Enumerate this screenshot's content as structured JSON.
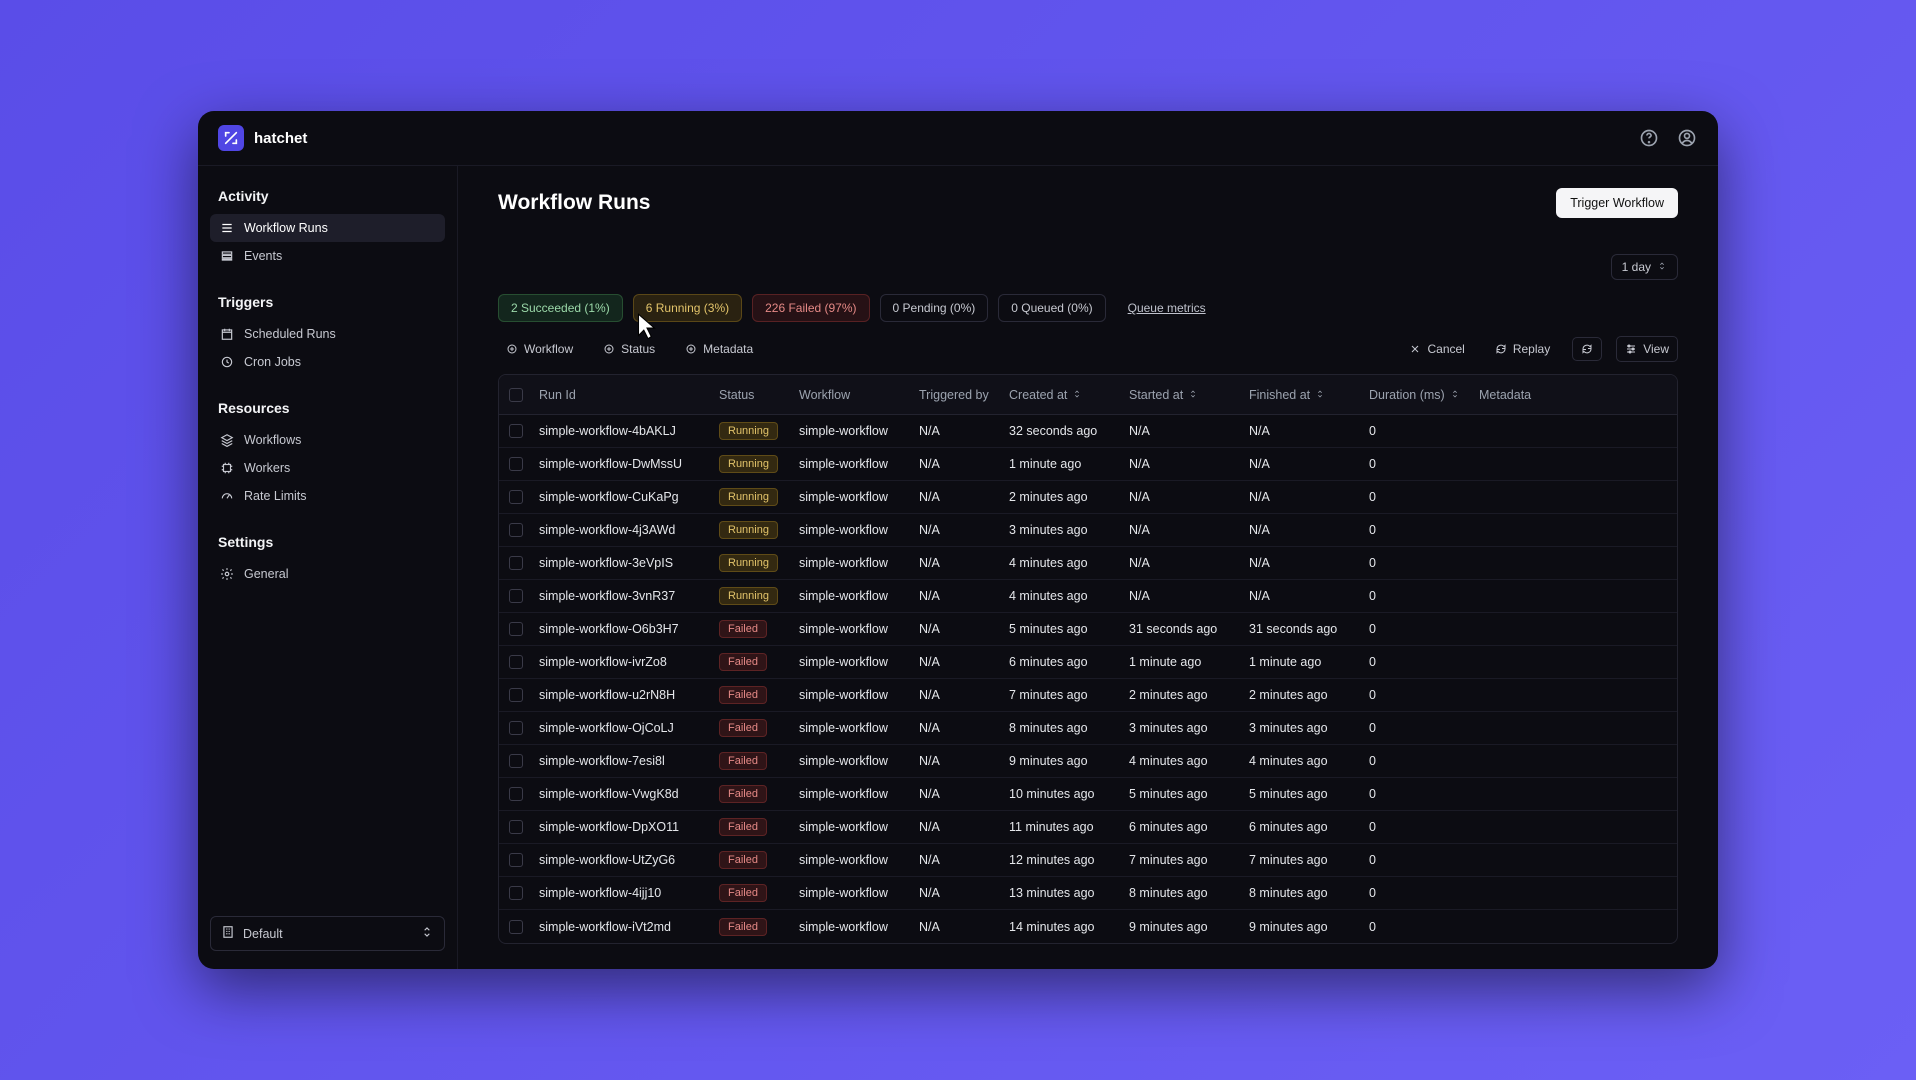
{
  "brand": "hatchet",
  "sidebar": {
    "sections": [
      {
        "heading": "Activity",
        "items": [
          {
            "label": "Workflow Runs",
            "icon": "list",
            "active": true
          },
          {
            "label": "Events",
            "icon": "rows"
          }
        ]
      },
      {
        "heading": "Triggers",
        "items": [
          {
            "label": "Scheduled Runs",
            "icon": "calendar"
          },
          {
            "label": "Cron Jobs",
            "icon": "clock"
          }
        ]
      },
      {
        "heading": "Resources",
        "items": [
          {
            "label": "Workflows",
            "icon": "layers"
          },
          {
            "label": "Workers",
            "icon": "chip"
          },
          {
            "label": "Rate Limits",
            "icon": "gauge"
          }
        ]
      },
      {
        "heading": "Settings",
        "items": [
          {
            "label": "General",
            "icon": "gear"
          }
        ]
      }
    ],
    "footer_label": "Default"
  },
  "page": {
    "title": "Workflow Runs",
    "trigger_button": "Trigger Workflow",
    "range": "1 day"
  },
  "status_chips": [
    {
      "text": "2 Succeeded (1%)",
      "cls": "ok"
    },
    {
      "text": "6 Running (3%)",
      "cls": "run"
    },
    {
      "text": "226 Failed (97%)",
      "cls": "fail"
    },
    {
      "text": "0 Pending (0%)",
      "cls": ""
    },
    {
      "text": "0 Queued (0%)",
      "cls": ""
    },
    {
      "text": "Queue metrics",
      "cls": "link"
    }
  ],
  "filters": {
    "left": [
      {
        "label": "Workflow",
        "icon": "plus"
      },
      {
        "label": "Status",
        "icon": "plus"
      },
      {
        "label": "Metadata",
        "icon": "plus"
      }
    ],
    "right": [
      {
        "label": "Cancel",
        "icon": "x",
        "bordered": false
      },
      {
        "label": "Replay",
        "icon": "refresh",
        "bordered": false
      },
      {
        "label": "",
        "icon": "refresh",
        "bordered": true,
        "icononly": true
      },
      {
        "label": "View",
        "icon": "sliders",
        "bordered": true
      }
    ]
  },
  "table": {
    "headers": [
      "",
      "Run Id",
      "Status",
      "Workflow",
      "Triggered by",
      "Created at",
      "Started at",
      "Finished at",
      "Duration (ms)",
      "Metadata"
    ],
    "sortable": [
      false,
      false,
      false,
      false,
      false,
      true,
      true,
      true,
      true,
      false
    ],
    "rows": [
      {
        "id": "simple-workflow-4bAKLJ",
        "status": "Running",
        "workflow": "simple-workflow",
        "triggered": "N/A",
        "created": "32 seconds ago",
        "started": "N/A",
        "finished": "N/A",
        "duration": "0"
      },
      {
        "id": "simple-workflow-DwMssU",
        "status": "Running",
        "workflow": "simple-workflow",
        "triggered": "N/A",
        "created": "1 minute ago",
        "started": "N/A",
        "finished": "N/A",
        "duration": "0"
      },
      {
        "id": "simple-workflow-CuKaPg",
        "status": "Running",
        "workflow": "simple-workflow",
        "triggered": "N/A",
        "created": "2 minutes ago",
        "started": "N/A",
        "finished": "N/A",
        "duration": "0"
      },
      {
        "id": "simple-workflow-4j3AWd",
        "status": "Running",
        "workflow": "simple-workflow",
        "triggered": "N/A",
        "created": "3 minutes ago",
        "started": "N/A",
        "finished": "N/A",
        "duration": "0"
      },
      {
        "id": "simple-workflow-3eVpIS",
        "status": "Running",
        "workflow": "simple-workflow",
        "triggered": "N/A",
        "created": "4 minutes ago",
        "started": "N/A",
        "finished": "N/A",
        "duration": "0"
      },
      {
        "id": "simple-workflow-3vnR37",
        "status": "Running",
        "workflow": "simple-workflow",
        "triggered": "N/A",
        "created": "4 minutes ago",
        "started": "N/A",
        "finished": "N/A",
        "duration": "0"
      },
      {
        "id": "simple-workflow-O6b3H7",
        "status": "Failed",
        "workflow": "simple-workflow",
        "triggered": "N/A",
        "created": "5 minutes ago",
        "started": "31 seconds ago",
        "finished": "31 seconds ago",
        "duration": "0"
      },
      {
        "id": "simple-workflow-ivrZo8",
        "status": "Failed",
        "workflow": "simple-workflow",
        "triggered": "N/A",
        "created": "6 minutes ago",
        "started": "1 minute ago",
        "finished": "1 minute ago",
        "duration": "0"
      },
      {
        "id": "simple-workflow-u2rN8H",
        "status": "Failed",
        "workflow": "simple-workflow",
        "triggered": "N/A",
        "created": "7 minutes ago",
        "started": "2 minutes ago",
        "finished": "2 minutes ago",
        "duration": "0"
      },
      {
        "id": "simple-workflow-OjCoLJ",
        "status": "Failed",
        "workflow": "simple-workflow",
        "triggered": "N/A",
        "created": "8 minutes ago",
        "started": "3 minutes ago",
        "finished": "3 minutes ago",
        "duration": "0"
      },
      {
        "id": "simple-workflow-7esi8l",
        "status": "Failed",
        "workflow": "simple-workflow",
        "triggered": "N/A",
        "created": "9 minutes ago",
        "started": "4 minutes ago",
        "finished": "4 minutes ago",
        "duration": "0"
      },
      {
        "id": "simple-workflow-VwgK8d",
        "status": "Failed",
        "workflow": "simple-workflow",
        "triggered": "N/A",
        "created": "10 minutes ago",
        "started": "5 minutes ago",
        "finished": "5 minutes ago",
        "duration": "0"
      },
      {
        "id": "simple-workflow-DpXO11",
        "status": "Failed",
        "workflow": "simple-workflow",
        "triggered": "N/A",
        "created": "11 minutes ago",
        "started": "6 minutes ago",
        "finished": "6 minutes ago",
        "duration": "0"
      },
      {
        "id": "simple-workflow-UtZyG6",
        "status": "Failed",
        "workflow": "simple-workflow",
        "triggered": "N/A",
        "created": "12 minutes ago",
        "started": "7 minutes ago",
        "finished": "7 minutes ago",
        "duration": "0"
      },
      {
        "id": "simple-workflow-4ijj10",
        "status": "Failed",
        "workflow": "simple-workflow",
        "triggered": "N/A",
        "created": "13 minutes ago",
        "started": "8 minutes ago",
        "finished": "8 minutes ago",
        "duration": "0"
      },
      {
        "id": "simple-workflow-iVt2md",
        "status": "Failed",
        "workflow": "simple-workflow",
        "triggered": "N/A",
        "created": "14 minutes ago",
        "started": "9 minutes ago",
        "finished": "9 minutes ago",
        "duration": "0"
      }
    ]
  }
}
